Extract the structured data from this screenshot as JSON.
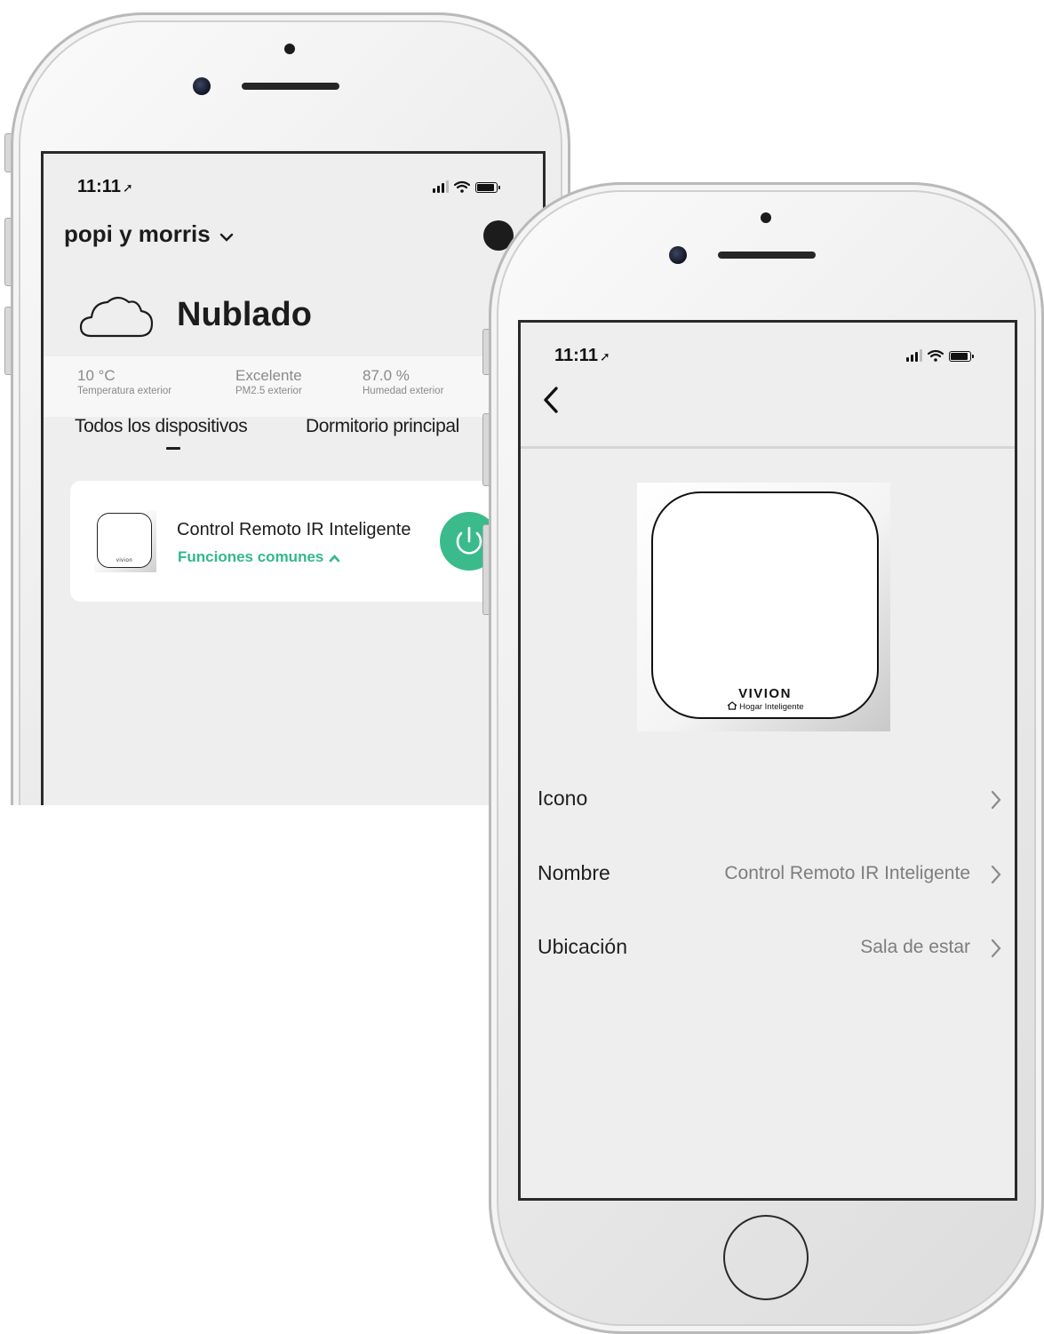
{
  "back_screen": {
    "status_bar": {
      "time": "11:11",
      "location_arrow": "➚"
    },
    "header": {
      "home_name": "popi y morris",
      "chevron": "⌄"
    },
    "weather": {
      "icon": "cloud-icon",
      "condition": "Nublado",
      "stats": [
        {
          "value": "10 °C",
          "label": "Temperatura exterior"
        },
        {
          "value": "Excelente",
          "label": "PM2.5 exterior"
        },
        {
          "value": "87.0 %",
          "label": "Humedad exterior"
        }
      ]
    },
    "tabs": [
      {
        "label": "Todos los dispositivos",
        "active": true
      },
      {
        "label": "Dormitorio principal",
        "active": false
      }
    ],
    "device_card": {
      "name": "Control Remoto IR Inteligente",
      "functions_label": "Funciones comunes",
      "functions_chevron": "⌃",
      "thumb_logo": "vivion",
      "power_color": "#3bbb8b"
    }
  },
  "front_screen": {
    "status_bar": {
      "time": "11:11",
      "location_arrow": "➚"
    },
    "device_image": {
      "brand": "VIVION",
      "tagline": "Hogar Inteligente"
    },
    "settings": [
      {
        "label": "Icono",
        "value": ""
      },
      {
        "label": "Nombre",
        "value": "Control Remoto IR Inteligente"
      },
      {
        "label": "Ubicación",
        "value": "Sala de estar"
      }
    ]
  },
  "colors": {
    "accent": "#33b88a",
    "screen_bg": "#eeeeee",
    "card_bg": "#ffffff"
  }
}
